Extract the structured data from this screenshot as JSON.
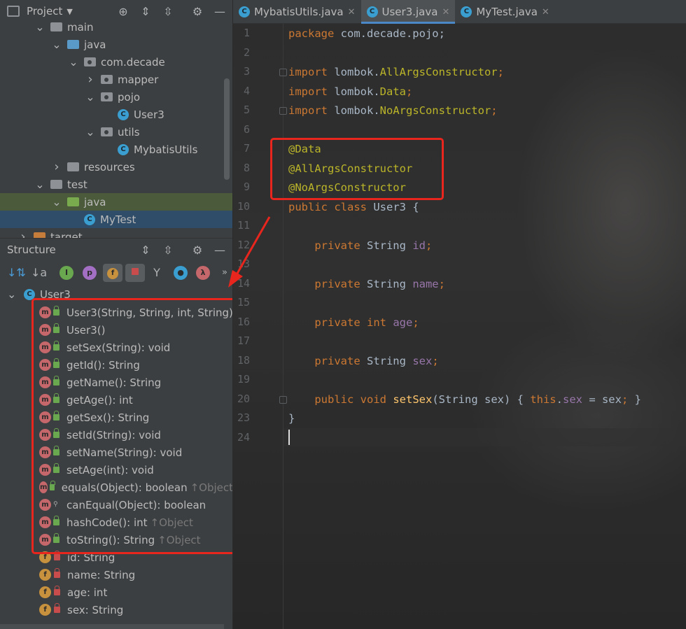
{
  "project_panel": {
    "title": "Project",
    "tree": [
      {
        "label": "main",
        "kind": "folder-gray",
        "depth": 3,
        "expanded": true
      },
      {
        "label": "java",
        "kind": "folder-blue",
        "depth": 4,
        "expanded": true
      },
      {
        "label": "com.decade",
        "kind": "package",
        "depth": 5,
        "expanded": true
      },
      {
        "label": "mapper",
        "kind": "package",
        "depth": 6,
        "expanded": false
      },
      {
        "label": "pojo",
        "kind": "package",
        "depth": 6,
        "expanded": true
      },
      {
        "label": "User3",
        "kind": "class",
        "depth": 7
      },
      {
        "label": "utils",
        "kind": "package",
        "depth": 6,
        "expanded": true
      },
      {
        "label": "MybatisUtils",
        "kind": "class",
        "depth": 7
      },
      {
        "label": "resources",
        "kind": "folder-resources",
        "depth": 4,
        "expanded": false
      },
      {
        "label": "test",
        "kind": "folder-gray",
        "depth": 3,
        "expanded": true
      },
      {
        "label": "java",
        "kind": "folder-green",
        "depth": 4,
        "expanded": true
      },
      {
        "label": "MyTest",
        "kind": "class",
        "depth": 5
      },
      {
        "label": "target",
        "kind": "folder-orange",
        "depth": 2,
        "expanded": false
      }
    ]
  },
  "structure_panel": {
    "title": "Structure",
    "root": "User3",
    "members": [
      {
        "label": "User3(String, String, int, String)",
        "icon": "m",
        "access": "public"
      },
      {
        "label": "User3()",
        "icon": "m",
        "access": "public"
      },
      {
        "label": "setSex(String): void",
        "icon": "m",
        "access": "public"
      },
      {
        "label": "getId(): String",
        "icon": "m",
        "access": "public"
      },
      {
        "label": "getName(): String",
        "icon": "m",
        "access": "public"
      },
      {
        "label": "getAge(): int",
        "icon": "m",
        "access": "public"
      },
      {
        "label": "getSex(): String",
        "icon": "m",
        "access": "public"
      },
      {
        "label": "setId(String): void",
        "icon": "m",
        "access": "public"
      },
      {
        "label": "setName(String): void",
        "icon": "m",
        "access": "public"
      },
      {
        "label": "setAge(int): void",
        "icon": "m",
        "access": "public"
      },
      {
        "label": "equals(Object): boolean",
        "icon": "m",
        "access": "public",
        "inherited": "↑Object"
      },
      {
        "label": "canEqual(Object): boolean",
        "icon": "m",
        "access": "protected"
      },
      {
        "label": "hashCode(): int",
        "icon": "m",
        "access": "public",
        "inherited": "↑Object"
      },
      {
        "label": "toString(): String",
        "icon": "m",
        "access": "public",
        "inherited": "↑Object"
      },
      {
        "label": "id: String",
        "icon": "f",
        "access": "private"
      },
      {
        "label": "name: String",
        "icon": "f",
        "access": "private"
      },
      {
        "label": "age: int",
        "icon": "f",
        "access": "private"
      },
      {
        "label": "sex: String",
        "icon": "f",
        "access": "private"
      }
    ]
  },
  "tabs": [
    {
      "label": "MybatisUtils.java",
      "active": false
    },
    {
      "label": "User3.java",
      "active": true
    },
    {
      "label": "MyTest.java",
      "active": false
    }
  ],
  "editor": {
    "line_numbers": [
      "1",
      "2",
      "3",
      "4",
      "5",
      "6",
      "7",
      "8",
      "9",
      "10",
      "11",
      "12",
      "13",
      "14",
      "15",
      "16",
      "17",
      "18",
      "19",
      "20",
      "23",
      "24"
    ],
    "lines": [
      [
        {
          "t": "package ",
          "c": "kw"
        },
        {
          "t": "com.decade.pojo;",
          "c": "txt"
        }
      ],
      [],
      [
        {
          "t": "import ",
          "c": "kw"
        },
        {
          "t": "lombok.",
          "c": "txt"
        },
        {
          "t": "AllArgsConstructor",
          "c": "ann"
        },
        {
          "t": ";",
          "c": "kw"
        }
      ],
      [
        {
          "t": "import ",
          "c": "kw"
        },
        {
          "t": "lombok.",
          "c": "txt"
        },
        {
          "t": "Data",
          "c": "ann"
        },
        {
          "t": ";",
          "c": "kw"
        }
      ],
      [
        {
          "t": "import ",
          "c": "kw"
        },
        {
          "t": "lombok.",
          "c": "txt"
        },
        {
          "t": "NoArgsConstructor",
          "c": "ann"
        },
        {
          "t": ";",
          "c": "kw"
        }
      ],
      [],
      [
        {
          "t": "@Data",
          "c": "ann"
        }
      ],
      [
        {
          "t": "@AllArgsConstructor",
          "c": "ann"
        }
      ],
      [
        {
          "t": "@NoArgsConstructor",
          "c": "ann"
        }
      ],
      [
        {
          "t": "public ",
          "c": "kw"
        },
        {
          "t": "class ",
          "c": "kw"
        },
        {
          "t": "User3 {",
          "c": "txt"
        }
      ],
      [],
      [
        {
          "t": "    private ",
          "c": "kw"
        },
        {
          "t": "String ",
          "c": "txt"
        },
        {
          "t": "id",
          "c": "fld"
        },
        {
          "t": ";",
          "c": "kw"
        }
      ],
      [],
      [
        {
          "t": "    private ",
          "c": "kw"
        },
        {
          "t": "String ",
          "c": "txt"
        },
        {
          "t": "name",
          "c": "fld"
        },
        {
          "t": ";",
          "c": "kw"
        }
      ],
      [],
      [
        {
          "t": "    private ",
          "c": "kw"
        },
        {
          "t": "int ",
          "c": "kw"
        },
        {
          "t": "age",
          "c": "fld"
        },
        {
          "t": ";",
          "c": "kw"
        }
      ],
      [],
      [
        {
          "t": "    private ",
          "c": "kw"
        },
        {
          "t": "String ",
          "c": "txt"
        },
        {
          "t": "sex",
          "c": "fld"
        },
        {
          "t": ";",
          "c": "kw"
        }
      ],
      [],
      [
        {
          "t": "    public ",
          "c": "kw"
        },
        {
          "t": "void ",
          "c": "kw"
        },
        {
          "t": "setSex",
          "c": "meth"
        },
        {
          "t": "(String sex) { ",
          "c": "txt"
        },
        {
          "t": "this",
          "c": "kw"
        },
        {
          "t": ".",
          "c": "txt"
        },
        {
          "t": "sex",
          "c": "fld"
        },
        {
          "t": " = sex",
          "c": "txt"
        },
        {
          "t": ";",
          "c": "kw"
        },
        {
          "t": " }",
          "c": "txt"
        }
      ],
      [
        {
          "t": "}",
          "c": "txt"
        }
      ],
      []
    ]
  },
  "colors": {
    "highlight_box": "#e8261e",
    "keyword": "#cc7832",
    "annotation": "#bbb529",
    "field": "#9876aa",
    "method": "#ffc66d"
  }
}
